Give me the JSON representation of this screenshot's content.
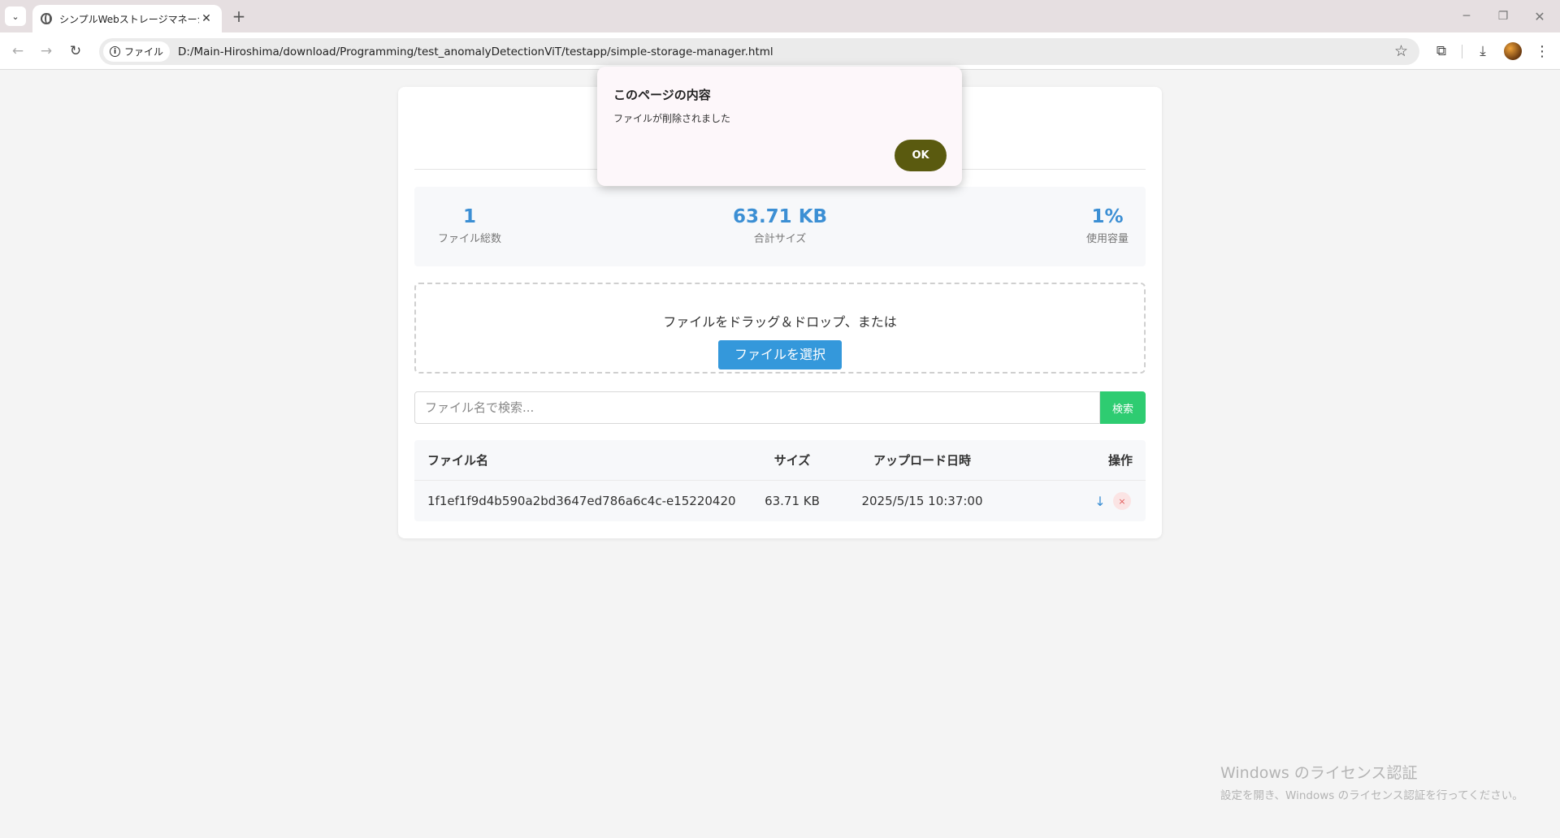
{
  "browser": {
    "tab_title": "シンプルWebストレージマネージャー",
    "tab_close": "✕",
    "new_tab": "+",
    "url_chip": "ファイル",
    "url": "D:/Main-Hiroshima/download/Programming/test_anomalyDetectionViT/testapp/simple-storage-manager.html"
  },
  "stats": {
    "count_value": "1",
    "count_label": "ファイル総数",
    "size_value": "63.71 KB",
    "size_label": "合計サイズ",
    "usage_value": "1%",
    "usage_label": "使用容量"
  },
  "dropzone": {
    "text": "ファイルをドラッグ＆ドロップ、または",
    "button": "ファイルを選択"
  },
  "search": {
    "placeholder": "ファイル名で検索...",
    "button": "検索"
  },
  "table": {
    "headers": {
      "name": "ファイル名",
      "size": "サイズ",
      "date": "アップロード日時",
      "actions": "操作"
    },
    "rows": [
      {
        "name": "1f1ef1f9d4b590a2bd3647ed786a6c4c-e15220420...",
        "size": "63.71 KB",
        "date": "2025/5/15 10:37:00",
        "download_icon": "↓",
        "delete_icon": "×"
      }
    ]
  },
  "dialog": {
    "title": "このページの内容",
    "message": "ファイルが削除されました",
    "ok": "OK"
  },
  "watermark": {
    "title": "Windows のライセンス認証",
    "subtitle": "設定を開き、Windows のライセンス認証を行ってください。"
  },
  "colors": {
    "accent_blue": "#3498db",
    "search_green": "#2ecc71",
    "dialog_ok": "#5a5a0f"
  }
}
